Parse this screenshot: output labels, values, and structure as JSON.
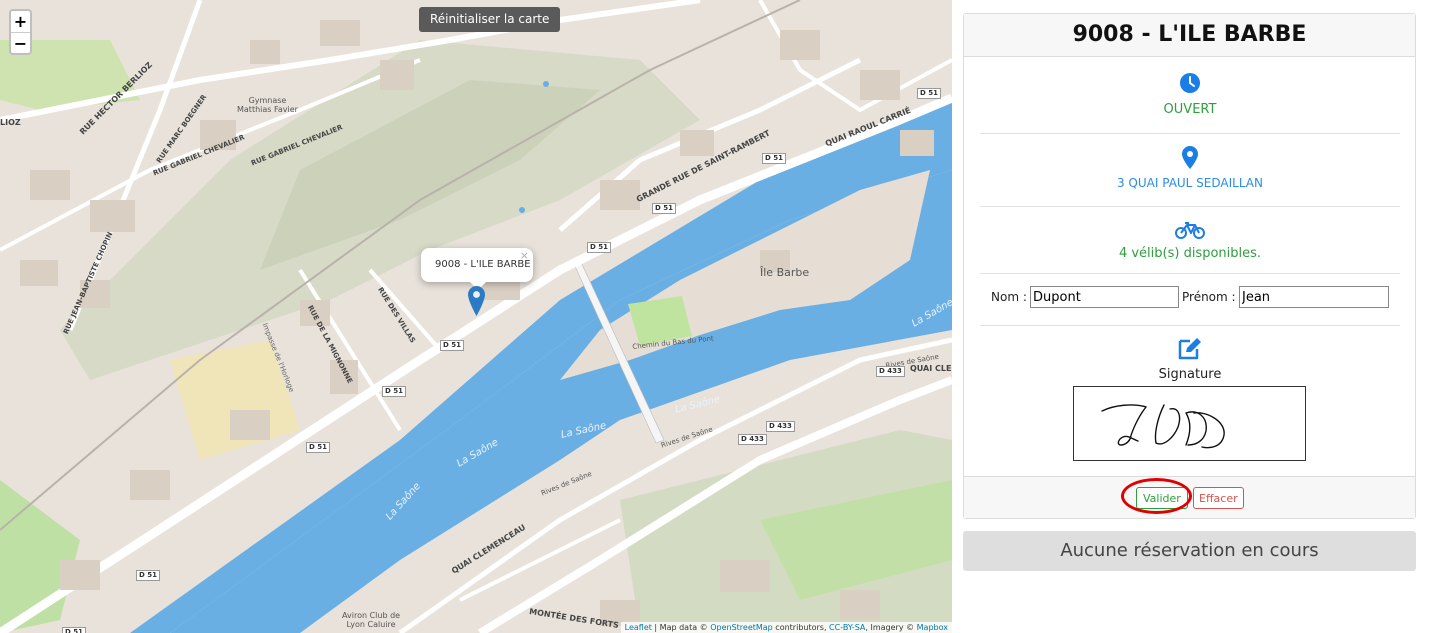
{
  "map": {
    "zoom_in": "+",
    "zoom_out": "−",
    "reset_label": "Réinitialiser la carte",
    "popup_title": "9008 - L'ILE BARBE",
    "popup_close": "×",
    "attribution": {
      "leaflet": "Leaflet",
      "sep1": " | Map data © ",
      "osm": "OpenStreetMap",
      "mid": " contributors, ",
      "cc": "CC-BY-SA",
      "imagery": ", Imagery © ",
      "mapbox": "Mapbox"
    },
    "labels": {
      "ile_barbe": "Île Barbe",
      "gymnase": "Gymnase\nMatthias Favier",
      "grande_rue": "GRANDE RUE DE SAINT-RAMBERT",
      "quai_raoul": "QUAI RAOUL CARRIÉ",
      "quai_clemenceau": "QUAI CLEMENCEAU",
      "montee_forts": "MONTÉE DES FORTS",
      "rue_villas": "RUE DES VILLAS",
      "rue_mignonne": "RUE DE LA MIGNONNE",
      "rue_chevalier": "RUE GABRIEL CHEVALIER",
      "rue_boegner": "RUE MARC BOEGNER",
      "rue_berlioz": "RUE HECTOR BERLIOZ",
      "rue_chopin": "RUE JEAN-BAPTISTE CHOPIN",
      "chemin_bas_pont": "Chemin du Bas du Pont",
      "rives_saone": "Rives de Saône",
      "la_saone": "La Saône",
      "aviron": "Aviron Club de\nLyon Caluire",
      "impasse_horloge": "Impasse de l'Horloge",
      "quai_cle": "QUAI CLE",
      "lioz": "LIOZ",
      "d51": "D 51",
      "d433": "D 433"
    }
  },
  "station": {
    "title": "9008 - L'ILE BARBE",
    "status": "OUVERT",
    "address": "3 QUAI PAUL SEDAILLAN",
    "bikes": "4 vélib(s) disponibles.",
    "nom_label": "Nom :",
    "nom_value": "Dupont",
    "prenom_label": "Prénom :",
    "prenom_value": "Jean",
    "signature_label": "Signature",
    "validate_label": "Valider",
    "clear_label": "Effacer"
  },
  "reservation": {
    "status": "Aucune réservation en cours"
  },
  "colors": {
    "water": "#6aafe4",
    "accent_blue": "#1a7ee6",
    "ok_green": "#2e9e3e",
    "danger_red": "#d9534f"
  },
  "icons": [
    "clock-icon",
    "map-pin-icon",
    "bicycle-icon",
    "edit-icon",
    "map-marker-icon"
  ]
}
